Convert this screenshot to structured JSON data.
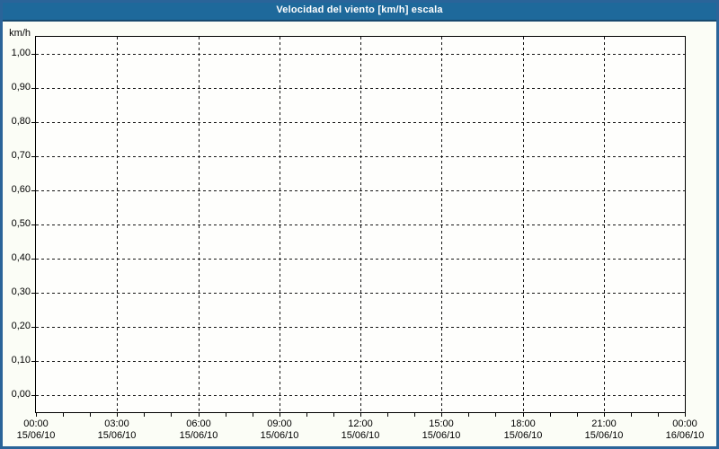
{
  "title": "Velocidad del viento [km/h] escala",
  "colors": {
    "titlebar_bg": "#1E699B",
    "titlebar_border": "#17496E",
    "title_text": "#FFFFFF",
    "window_border": "#2A6499",
    "window_bg": "#FBFDF6",
    "plot_bg": "#FEFEFC",
    "grid": "#151515",
    "axis": "#000000",
    "text": "#000000"
  },
  "chart_data": {
    "type": "line",
    "title": "Velocidad del viento [km/h] escala",
    "ylabel": "km/h",
    "ylim": [
      -0.05,
      1.05
    ],
    "y_ticks": [
      {
        "value": 1.0,
        "label": "1,00"
      },
      {
        "value": 0.9,
        "label": "0,90"
      },
      {
        "value": 0.8,
        "label": "0,80"
      },
      {
        "value": 0.7,
        "label": "0,70"
      },
      {
        "value": 0.6,
        "label": "0,60"
      },
      {
        "value": 0.5,
        "label": "0,50"
      },
      {
        "value": 0.4,
        "label": "0,40"
      },
      {
        "value": 0.3,
        "label": "0,30"
      },
      {
        "value": 0.2,
        "label": "0,20"
      },
      {
        "value": 0.1,
        "label": "0,10"
      },
      {
        "value": 0.0,
        "label": "0,00"
      }
    ],
    "x_axis": {
      "range_hours": [
        0,
        24
      ],
      "minor_tick_every_hours": 1,
      "major_tick_every_hours": 3,
      "major_labels": [
        {
          "hour": 0,
          "time": "00:00",
          "date": "15/06/10"
        },
        {
          "hour": 3,
          "time": "03:00",
          "date": "15/06/10"
        },
        {
          "hour": 6,
          "time": "06:00",
          "date": "15/06/10"
        },
        {
          "hour": 9,
          "time": "09:00",
          "date": "15/06/10"
        },
        {
          "hour": 12,
          "time": "12:00",
          "date": "15/06/10"
        },
        {
          "hour": 15,
          "time": "15:00",
          "date": "15/06/10"
        },
        {
          "hour": 18,
          "time": "18:00",
          "date": "15/06/10"
        },
        {
          "hour": 21,
          "time": "21:00",
          "date": "15/06/10"
        },
        {
          "hour": 24,
          "time": "00:00",
          "date": "16/06/10"
        }
      ]
    },
    "grid": {
      "style": "dashed",
      "horizontal": true,
      "vertical": true
    },
    "legend": null,
    "series": []
  }
}
